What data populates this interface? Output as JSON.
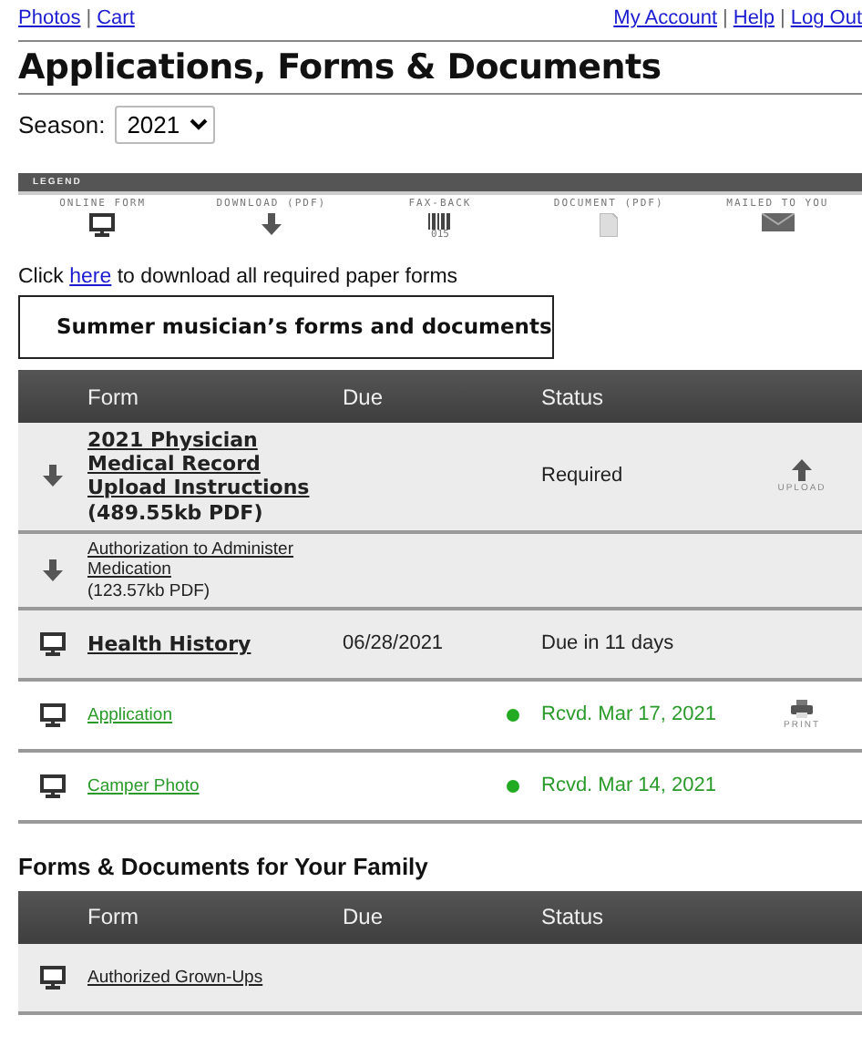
{
  "nav": {
    "separator": "|",
    "left": [
      "Photos",
      "Cart"
    ],
    "right": [
      "My Account",
      "Help",
      "Log Out"
    ]
  },
  "title": "Applications, Forms & Documents",
  "season": {
    "label": "Season:",
    "value": "2021"
  },
  "legend": {
    "title": "LEGEND",
    "items": [
      {
        "kind": "online",
        "label": "ONLINE FORM"
      },
      {
        "kind": "download",
        "label": "DOWNLOAD (PDF)"
      },
      {
        "kind": "fax",
        "label": "FAX-BACK",
        "code": "015"
      },
      {
        "kind": "document",
        "label": "DOCUMENT (PDF)"
      },
      {
        "kind": "mail",
        "label": "MAILED TO YOU"
      }
    ]
  },
  "download_note": {
    "before": "Click",
    "link": "here",
    "after": "to download all required paper forms"
  },
  "sections": [
    {
      "title": "Summer musician’s forms and documents",
      "boxed": true,
      "columns": [
        "Form",
        "Due",
        "Status"
      ],
      "rows": [
        {
          "kind": "download",
          "title": "2021 Physician Medical Record Upload Instructions",
          "size": "(489.55kb PDF)",
          "bold": true,
          "received": false,
          "status": "Required",
          "action": {
            "kind": "upload",
            "label": "UPLOAD"
          }
        },
        {
          "kind": "download",
          "title": "Authorization to Administer Medication",
          "size": "(123.57kb PDF)",
          "bold": false,
          "received": false
        },
        {
          "kind": "online",
          "title": "Health History",
          "bold": true,
          "received": false,
          "due": "06/28/2021",
          "status": "Due in 11 days"
        },
        {
          "kind": "online",
          "title": "Application",
          "bold": false,
          "received": true,
          "status": "Rcvd. Mar 17, 2021",
          "action": {
            "kind": "print",
            "label": "PRINT"
          }
        },
        {
          "kind": "online",
          "title": "Camper Photo",
          "bold": false,
          "received": true,
          "status": "Rcvd. Mar 14, 2021"
        }
      ]
    },
    {
      "title": "Forms & Documents for Your Family",
      "boxed": false,
      "columns": [
        "Form",
        "Due",
        "Status"
      ],
      "rows": [
        {
          "kind": "online",
          "title": "Authorized Grown-Ups",
          "bold": false,
          "received": false
        }
      ]
    }
  ]
}
